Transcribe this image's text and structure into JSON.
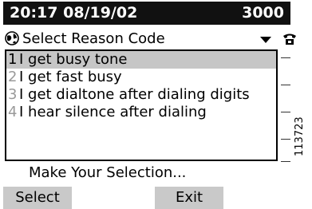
{
  "status_bar": {
    "time_date": "20:17 08/19/02",
    "extension": "3000"
  },
  "header": {
    "title": "Select Reason Code",
    "globe_icon": "globe-icon",
    "dropdown_icon": "dropdown-arrow-icon",
    "phone_icon": "phone-icon"
  },
  "list": {
    "items": [
      {
        "number": "1",
        "label": "I get busy tone",
        "selected": true
      },
      {
        "number": "2",
        "label": "I get fast busy",
        "selected": false
      },
      {
        "number": "3",
        "label": "I get dialtone after dialing digits",
        "selected": false
      },
      {
        "number": "4",
        "label": "I hear silence after dialing",
        "selected": false
      }
    ]
  },
  "prompt": "Make Your Selection...",
  "softkeys": {
    "select": "Select",
    "exit": "Exit"
  },
  "image_id": "113723"
}
